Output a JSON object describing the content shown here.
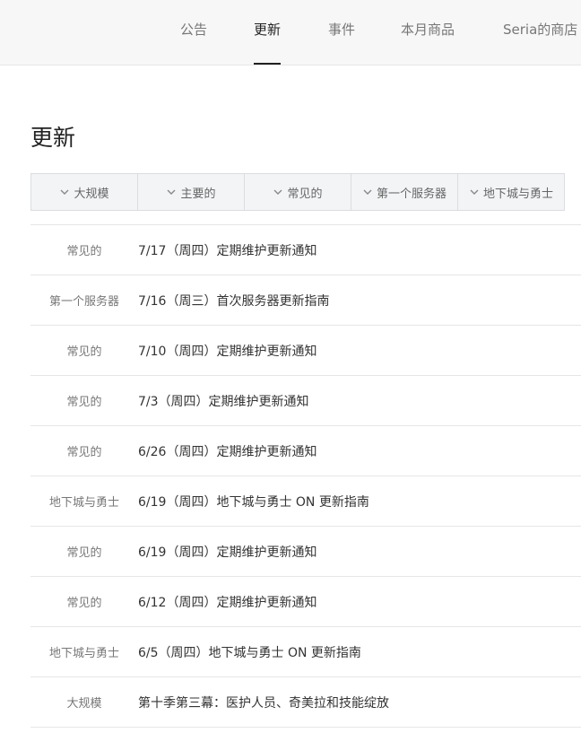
{
  "nav": {
    "tabs": [
      {
        "label": "公告",
        "active": false
      },
      {
        "label": "更新",
        "active": true
      },
      {
        "label": "事件",
        "active": false
      },
      {
        "label": "本月商品",
        "active": false
      },
      {
        "label": "Seria的商店",
        "active": false
      }
    ]
  },
  "page": {
    "title": "更新"
  },
  "filters": [
    {
      "label": "大规模"
    },
    {
      "label": "主要的"
    },
    {
      "label": "常见的"
    },
    {
      "label": "第一个服务器"
    },
    {
      "label": "地下城与勇士"
    }
  ],
  "updates": [
    {
      "category": "常见的",
      "title": "7/17（周四）定期维护更新通知"
    },
    {
      "category": "第一个服务器",
      "title": "7/16（周三）首次服务器更新指南"
    },
    {
      "category": "常见的",
      "title": "7/10（周四）定期维护更新通知"
    },
    {
      "category": "常见的",
      "title": "7/3（周四）定期维护更新通知"
    },
    {
      "category": "常见的",
      "title": "6/26（周四）定期维护更新通知"
    },
    {
      "category": "地下城与勇士",
      "title": "6/19（周四）地下城与勇士 ON 更新指南"
    },
    {
      "category": "常见的",
      "title": "6/19（周四）定期维护更新通知"
    },
    {
      "category": "常见的",
      "title": "6/12（周四）定期维护更新通知"
    },
    {
      "category": "地下城与勇士",
      "title": "6/5（周四）地下城与勇士 ON 更新指南"
    },
    {
      "category": "大规模",
      "title": "第十季第三幕：医护人员、奇美拉和技能绽放"
    }
  ]
}
